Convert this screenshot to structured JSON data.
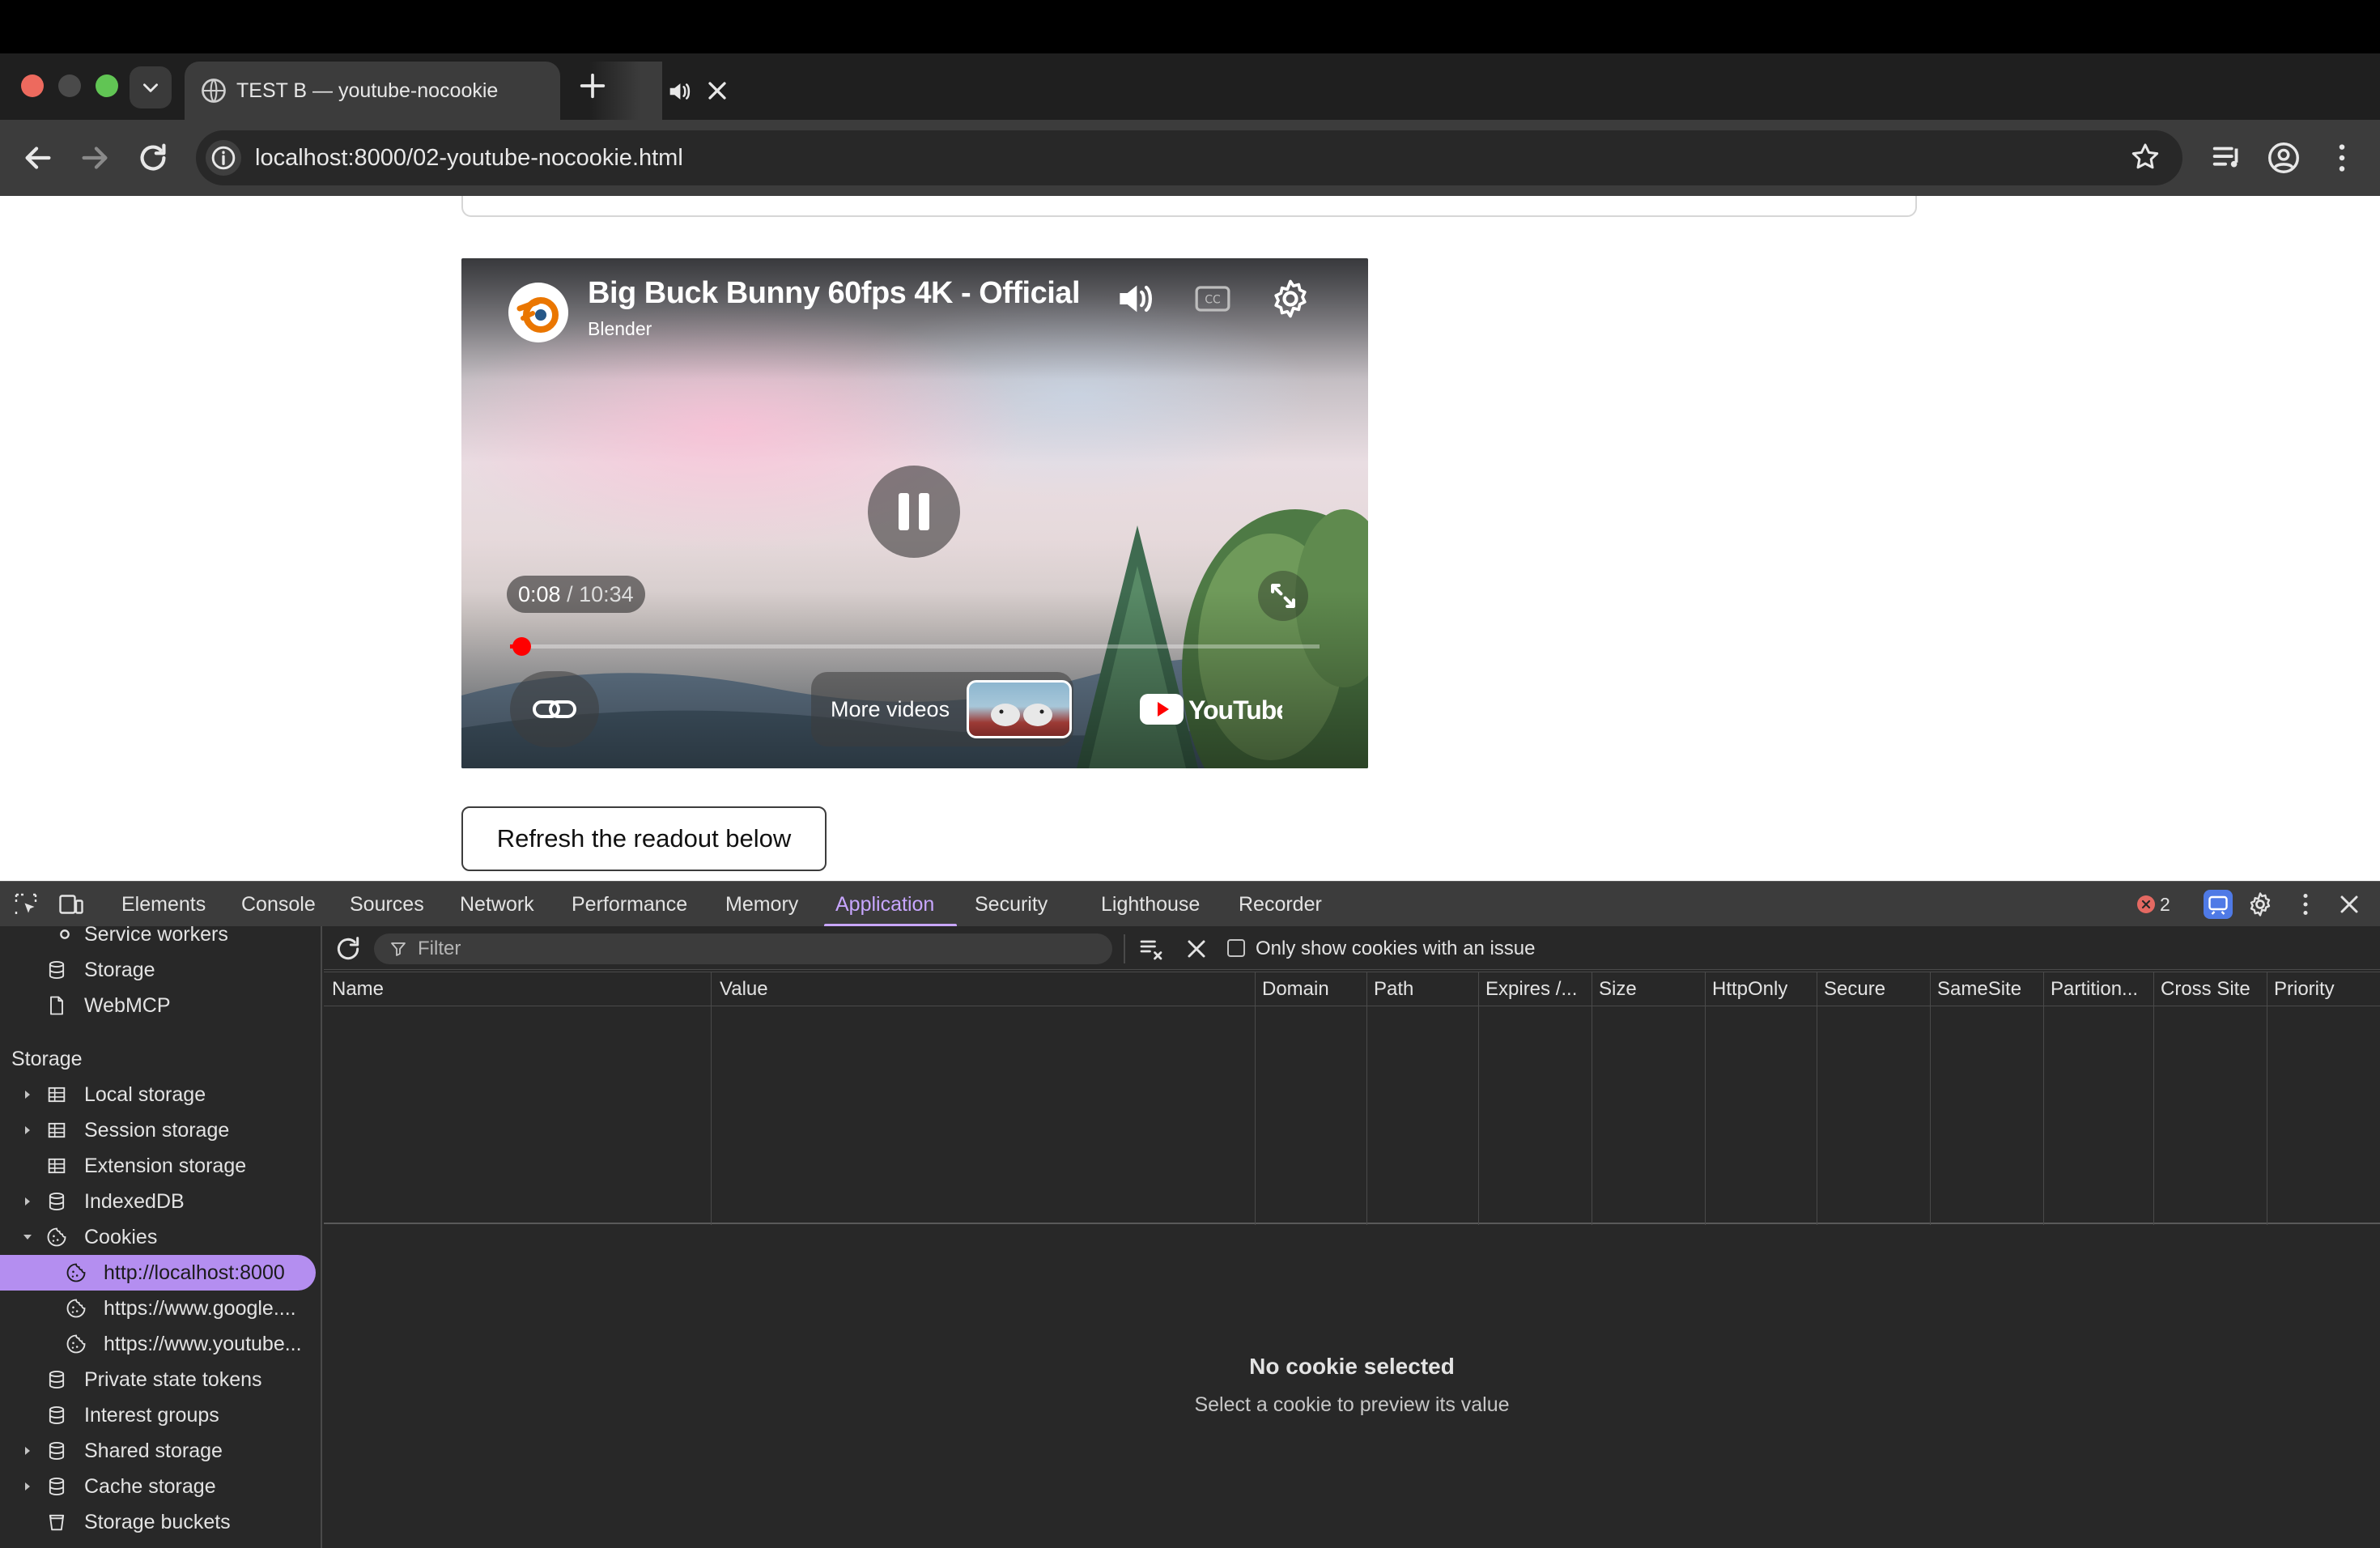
{
  "browser": {
    "tab_title": "TEST B — youtube-nocookie",
    "url": "localhost:8000/02-youtube-nocookie.html"
  },
  "player": {
    "title": "Big Buck Bunny 60fps 4K - Official",
    "channel": "Blender",
    "time_current": "0:08",
    "time_separator": " / ",
    "time_total": "10:34",
    "progress_fraction": 0.013,
    "more_videos_label": "More videos",
    "logo_text": "YouTube"
  },
  "page": {
    "refresh_button": "Refresh the readout below"
  },
  "devtools": {
    "tabs": [
      "Elements",
      "Console",
      "Sources",
      "Network",
      "Performance",
      "Memory",
      "Application",
      "Security",
      "Lighthouse",
      "Recorder"
    ],
    "active_tab": "Application",
    "error_count": "2",
    "sidebar": {
      "partial_item": "Service workers",
      "storage_item": "Storage",
      "webmcp_item": "WebMCP",
      "storage_heading": "Storage",
      "local_storage": "Local storage",
      "session_storage": "Session storage",
      "extension_storage": "Extension storage",
      "indexeddb": "IndexedDB",
      "cookies": "Cookies",
      "cookie_origins": [
        "http://localhost:8000",
        "https://www.google....",
        "https://www.youtube..."
      ],
      "private_state_tokens": "Private state tokens",
      "interest_groups": "Interest groups",
      "shared_storage": "Shared storage",
      "cache_storage": "Cache storage",
      "storage_buckets": "Storage buckets"
    },
    "cookies": {
      "filter_placeholder": "Filter",
      "only_issue_label": "Only show cookies with an issue",
      "columns": [
        "Name",
        "Value",
        "Domain",
        "Path",
        "Expires /...",
        "Size",
        "HttpOnly",
        "Secure",
        "SameSite",
        "Partition...",
        "Cross Site",
        "Priority"
      ],
      "empty_title": "No cookie selected",
      "empty_subtitle": "Select a cookie to preview its value"
    }
  },
  "colors": {
    "accent": "#c8a6ff",
    "selected_bg": "#b48ef0",
    "youtube_red": "#ff0000"
  }
}
